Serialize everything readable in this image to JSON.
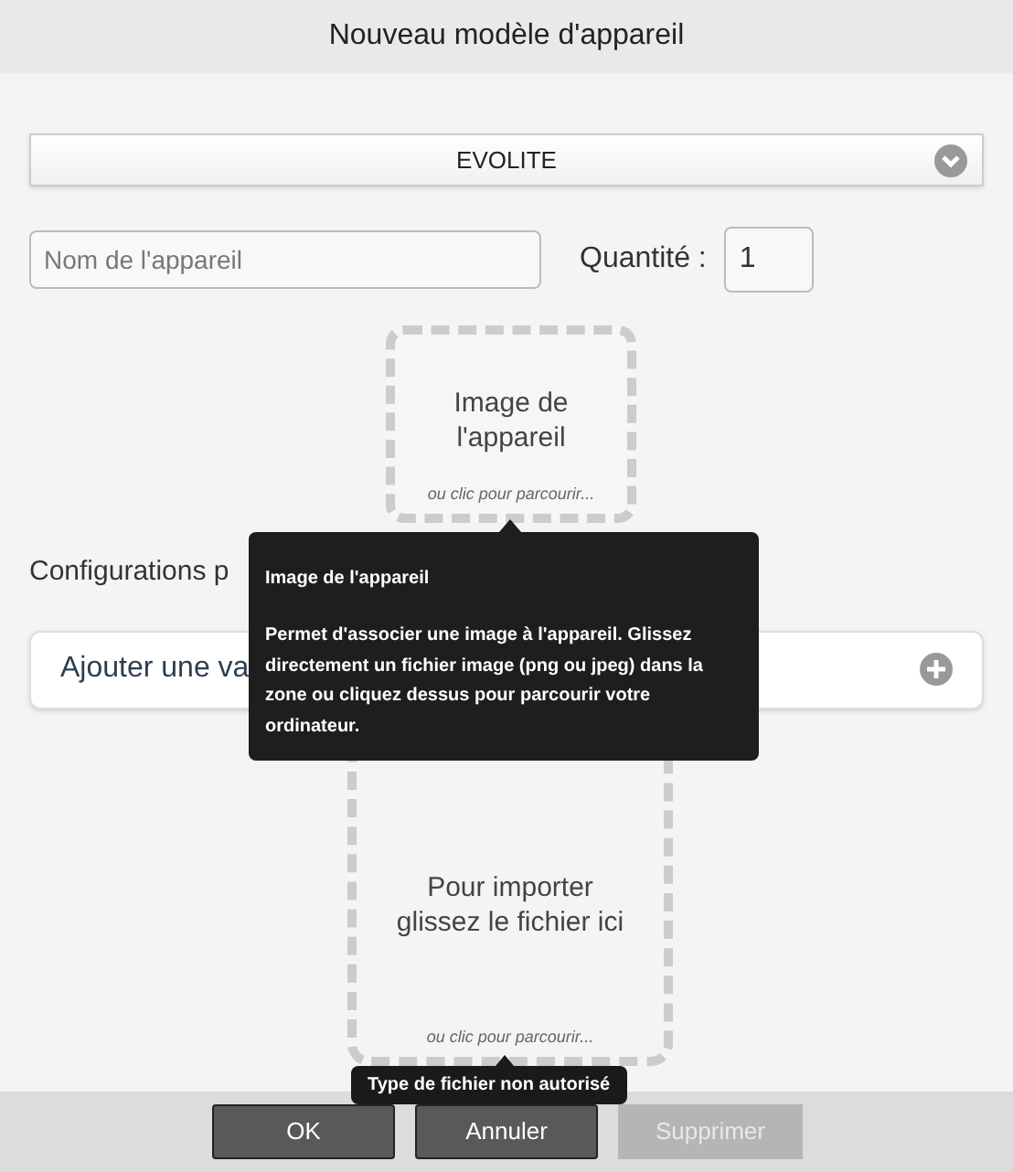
{
  "window": {
    "title": "Nouveau modèle d'appareil"
  },
  "model_select": {
    "value": "EVOLITE"
  },
  "name_field": {
    "placeholder": "Nom de l'appareil"
  },
  "quantity": {
    "label": "Quantité :",
    "value": "1"
  },
  "image_drop": {
    "title": "Image de l'appareil",
    "hint": "ou clic pour parcourir..."
  },
  "configurations": {
    "label": "Configurations p",
    "add_variant": "Ajouter une va"
  },
  "file_drop": {
    "title": "Pour importer glissez le fichier ici",
    "hint": "ou clic pour parcourir..."
  },
  "tooltips": [
    {
      "title": "Image de l'appareil",
      "text": "Permet d'associer une image à l'appareil. Glissez directement un fichier image (png ou jpeg) dans la zone ou cliquez dessus pour parcourir votre ordinateur."
    },
    {
      "text": "Type de fichier non autorisé"
    }
  ],
  "buttons": [
    {
      "label": "OK",
      "disabled": false
    },
    {
      "label": "Annuler",
      "disabled": false
    },
    {
      "label": "Supprimer",
      "disabled": true
    }
  ]
}
